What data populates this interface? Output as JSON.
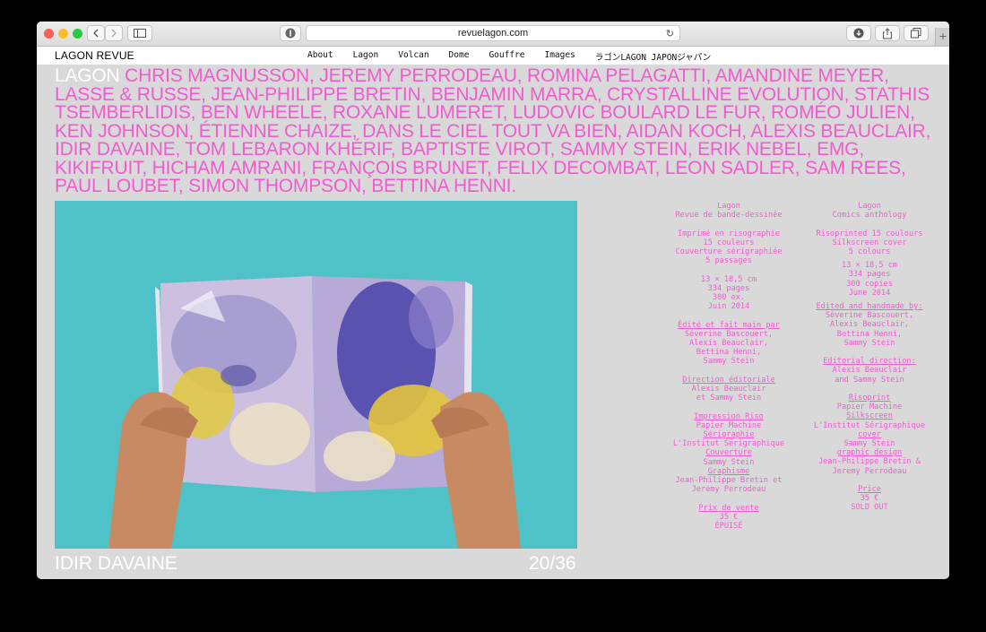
{
  "browser": {
    "url": "revuelagon.com",
    "new_tab_symbol": "+"
  },
  "site": {
    "brand": "LAGON REVUE",
    "nav": [
      "About",
      "Lagon",
      "Volcan",
      "Dome",
      "Gouffre",
      "Images",
      "ラゴンLAGON JAPONジャパン"
    ]
  },
  "headline": {
    "lead": "LAGON",
    "names": "CHRIS MAGNUSSON, JEREMY PERRODEAU, ROMINA PELAGATTI, AMANDINE MEYER, LASSE & RUSSE, JEAN-PHILIPPE BRETIN, BENJAMIN MARRA, CRYSTALLINE EVOLUTION, STATHIS TSEMBERLIDIS, BEN WHEELE, ROXANE LUMERET, LUDOVIC BOULARD LE FUR, ROMÉO JULIEN, KEN JOHNSON, ÉTIENNE CHAIZE, DANS LE CIEL TOUT VA BIEN, AIDAN KOCH, ALEXIS BEAUCLAIR, IDIR DAVAINE, TOM LEBARON KHÉRIF, BAPTISTE VIROT, SAMMY STEIN, ERIK NEBEL, EMG, KIKIFRUIT, HICHAM AMRANI, FRANÇOIS BRUNET, FELIX DECOMBAT, LEON SADLER, SAM REES, PAUL LOUBET, SIMON THOMPSON, BETTINA HENNI."
  },
  "slideshow": {
    "artist": "IDIR DAVAINE",
    "counter": "20/36"
  },
  "colors": {
    "accent_pink": "#f05cd0",
    "page_bg": "#d9d9d9",
    "photo_sky": "#4ec2c6"
  },
  "info_fr": {
    "title": "Lagon",
    "subtitle": "Revue de bande-dessinée",
    "print1": "Imprimé en risographie",
    "print2": "15 couleurs",
    "print3": "Couverture sérigraphiée",
    "print4": "5 passages",
    "spec1": "13 × 18,5 cm",
    "spec2": "334 pages",
    "spec3": "300 ex.",
    "spec4": "Juin 2014",
    "made_label": "Édité et fait main par",
    "made1": "Séverine Bascouert,",
    "made2": "Alexis Beauclair,",
    "made3": "Bettina Henni,",
    "made4": "Sammy Stein",
    "dir_label": "Direction éditoriale",
    "dir1": "Alexis Beauclair",
    "dir2": "et Sammy Stein",
    "riso_label": "Impression Riso",
    "riso1": "Papier Machine",
    "seri_label": "Sérigraphie",
    "seri1": "L'Institut Sérigraphique",
    "cover_label": "Couverture",
    "cover1": "Sammy Stein",
    "graph_label": "Graphisme",
    "graph1": "Jean-Philippe Bretin et",
    "graph2": "Jeremy Perrodeau",
    "price_label": "Prix de vente",
    "price": "35 €",
    "status": "ÉPUISÉ"
  },
  "info_en": {
    "title": "Lagon",
    "subtitle": "Comics anthology",
    "print1": "Risoprinted 15 coulours",
    "print2": "Silkscreen cover",
    "print3": "5 colours",
    "spec1": "13 × 18,5 cm",
    "spec2": "334 pages",
    "spec3": "300 copies",
    "spec4": "June 2014",
    "made_label": "Edited and handmade by:",
    "made1": "Séverine Bascouert,",
    "made2": "Alexis Beauclair,",
    "made3": "Bettina Henni,",
    "made4": "Sammy Stein",
    "dir_label": "Editorial direction:",
    "dir1": "Alexis Beauclair",
    "dir2": "and Sammy Stein",
    "riso_label": "Risoprint",
    "riso1": "Papier Machine",
    "silk_label": "Silkscreen",
    "silk1": "L'Institut Sérigraphique",
    "cover_label": "cover",
    "cover1": "Sammy Stein",
    "graph_label": "graphic design",
    "graph1": "Jean-Philippe Bretin &",
    "graph2": "Jeremy Perrodeau",
    "price_label": "Price",
    "price": "35 €",
    "status": "SOLD OUT"
  }
}
